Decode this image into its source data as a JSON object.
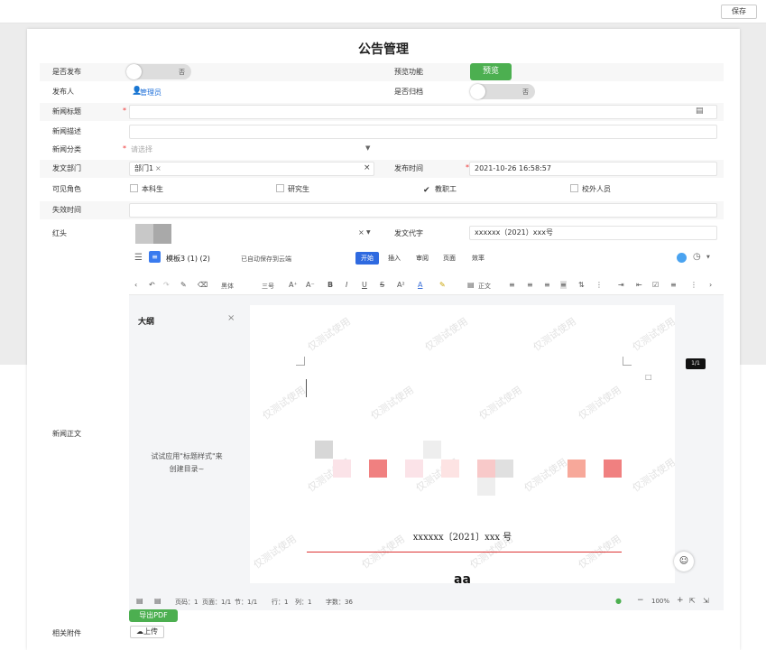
{
  "toolbar": {
    "save_label": "保存"
  },
  "page": {
    "title": "公告管理"
  },
  "form": {
    "publish_label": "是否发布",
    "publish_toggle": "否",
    "preview_label": "预览功能",
    "preview_button": "预览",
    "publisher_label": "发布人",
    "publisher_value": "管理员",
    "archive_label": "是否归档",
    "archive_toggle": "否",
    "news_title_label": "新闻标题",
    "news_desc_label": "新闻描述",
    "news_category_label": "新闻分类",
    "news_category_placeholder": "请选择",
    "dept_label": "发文部门",
    "dept_tag": "部门1",
    "publish_time_label": "发布时间",
    "publish_time_value": "2021-10-26 16:58:57",
    "roles_label": "可见角色",
    "roles": [
      {
        "label": "本科生",
        "checked": false
      },
      {
        "label": "研究生",
        "checked": false
      },
      {
        "label": "教职工",
        "checked": true
      },
      {
        "label": "校外人员",
        "checked": false
      }
    ],
    "expire_label": "失效时间",
    "header_label": "红头",
    "doc_code_label": "发文代字",
    "doc_code_value": "xxxxxx（2021）xxx号",
    "body_label": "新闻正文",
    "attachment_label": "相关附件",
    "upload_button": "上传",
    "export_pdf_button": "导出PDF"
  },
  "editor": {
    "doc_name": "模板3 (1) (2)",
    "autosave": "已自动保存到云端",
    "tabs": [
      "开始",
      "插入",
      "审阅",
      "页面",
      "效率"
    ],
    "font_name": "黑体",
    "font_size": "三号",
    "style_name": "正文",
    "outline_title": "大纲",
    "outline_hint_1": "试试应用\"标题样式\"来",
    "outline_hint_2": "创建目录~",
    "watermark": "仅测试使用",
    "doc_line": "xxxxxx〔2021〕xxx 号",
    "doc_bold": "aa",
    "page_badge": "1/1",
    "status_page": "页码：1",
    "status_pages": "页面：1/1",
    "status_section": "节：1/1",
    "status_row": "行：1",
    "status_col": "列：1",
    "status_words": "字数：36",
    "zoom": "100%"
  }
}
